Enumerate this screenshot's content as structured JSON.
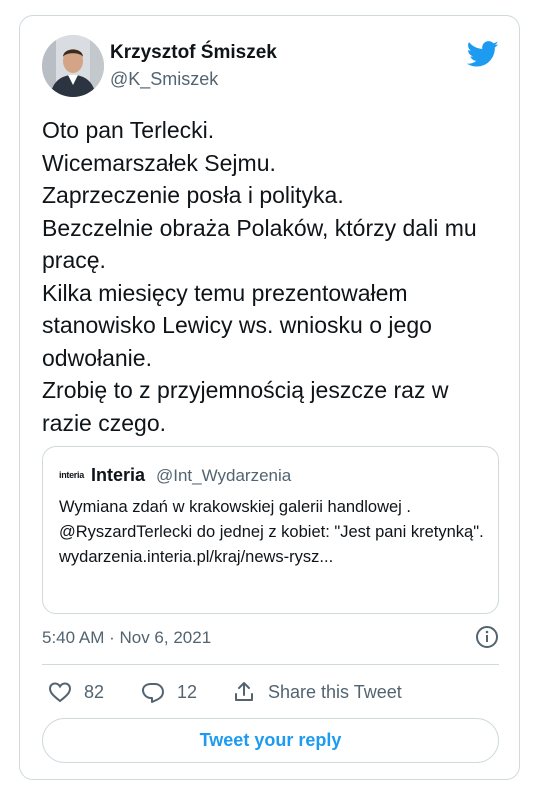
{
  "tweet": {
    "author_name": "Krzysztof Śmiszek",
    "author_handle": "@K_Smiszek",
    "text": "Oto pan Terlecki.\nWicemarszałek Sejmu.\nZaprzeczenie posła i polityka.\nBezczelnie obraża Polaków, którzy dali mu pracę.\nKilka miesięcy temu prezentowałem stanowisko Lewicy ws. wniosku o jego odwołanie.\nZrobię to z przyjemnością jeszcze raz w razie czego.",
    "timestamp": "5:40 AM · Nov 6, 2021"
  },
  "quoted_tweet": {
    "logo_text": "interia",
    "author_name": "Interia",
    "author_handle": "@Int_Wydarzenia",
    "text": "Wymiana zdań w krakowskiej galerii handlowej .\n@RyszardTerlecki do jednej z kobiet: \"Jest pani kretynką\".\nwydarzenia.interia.pl/kraj/news-rysz..."
  },
  "actions": {
    "likes_count": "82",
    "replies_count": "12",
    "share_label": "Share this Tweet"
  },
  "reply_button_label": "Tweet your reply",
  "colors": {
    "accent": "#1d9bf0",
    "text": "#0f1419",
    "muted": "#536471",
    "border": "#cfd9de"
  },
  "icons": [
    "twitter-bird-icon",
    "info-icon",
    "heart-icon",
    "reply-icon",
    "share-icon"
  ]
}
